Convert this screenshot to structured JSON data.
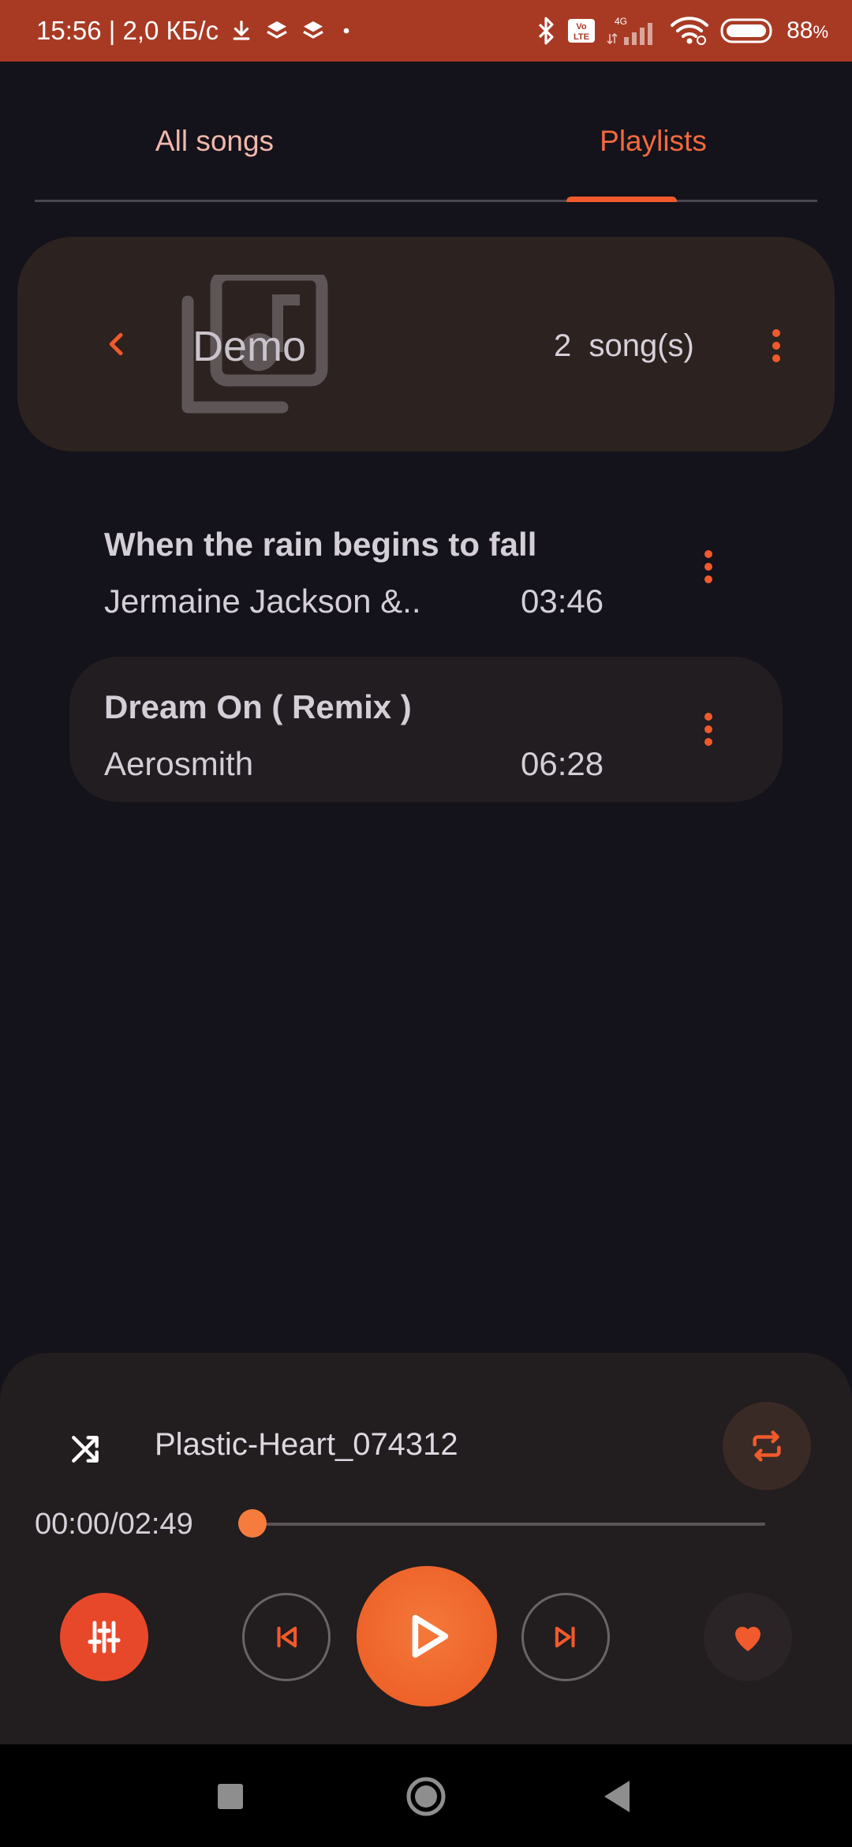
{
  "status_bar": {
    "time_speed": "15:56 | 2,0 КБ/с",
    "battery_percent": "88",
    "battery_unit": "%",
    "icons": [
      "download-icon",
      "layers-icon",
      "layers-icon",
      "dot-icon",
      "bluetooth-icon",
      "volte-icon",
      "signal-4g-icon",
      "wifi-icon",
      "battery-icon"
    ],
    "network_label": "4G",
    "volte_label": "Vo LTE"
  },
  "tabs": [
    {
      "label": "All songs",
      "selected": false
    },
    {
      "label": "Playlists",
      "selected": true
    }
  ],
  "playlist": {
    "name": "Demo",
    "count": "2",
    "count_suffix": "song(s)",
    "icons": {
      "back": "chevron-left-icon",
      "art": "music-library-icon",
      "more": "more-vertical-icon"
    }
  },
  "songs": [
    {
      "title": "When the rain begins to fall",
      "artist": "Jermaine Jackson &..",
      "duration": "03:46",
      "active": false
    },
    {
      "title": "Dream On ( Remix )",
      "artist": "Aerosmith",
      "duration": "06:28",
      "active": true
    }
  ],
  "player": {
    "track": "Plastic-Heart_074312",
    "time": "00:00/02:49",
    "progress": 0,
    "icons": {
      "shuffle": "shuffle-icon",
      "repeat": "repeat-icon",
      "equalizer": "equalizer-icon",
      "previous": "skip-previous-icon",
      "play": "play-icon",
      "next": "skip-next-icon",
      "favorite": "heart-icon"
    }
  },
  "nav": {
    "icons": [
      "recents-square-icon",
      "home-circle-icon",
      "back-triangle-icon"
    ]
  },
  "colors": {
    "accent": "#f05a2c",
    "status_bar": "#a83a24",
    "background": "#14121a",
    "card": "#2c2220",
    "player": "#221d1e"
  }
}
